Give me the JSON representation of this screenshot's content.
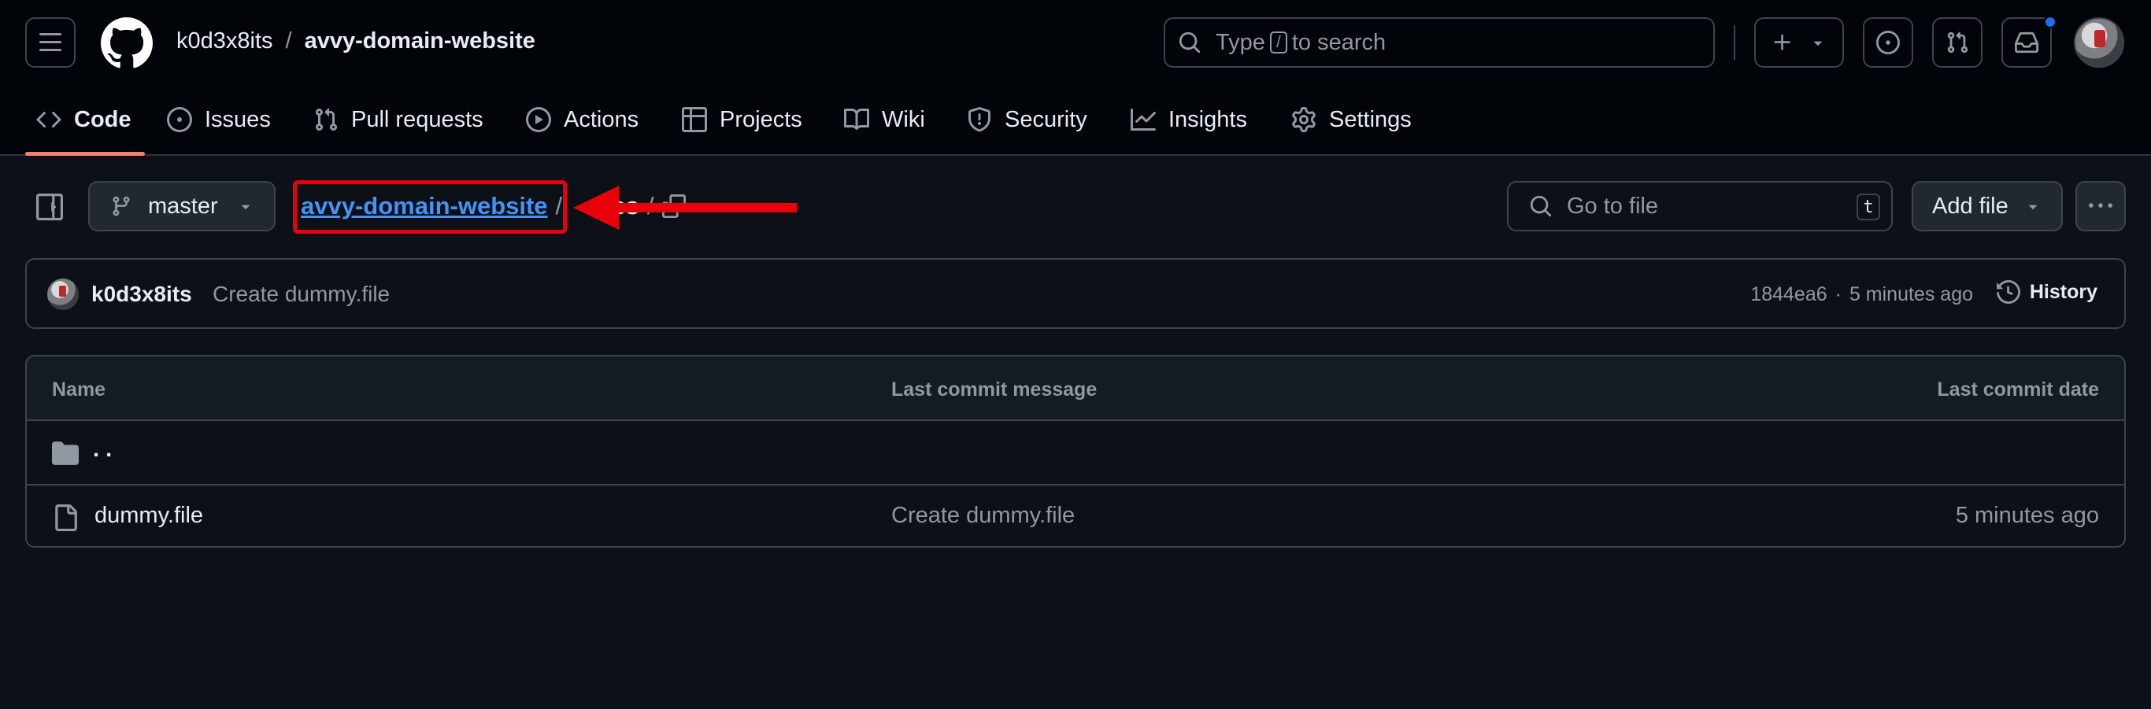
{
  "header": {
    "owner": "k0d3x8its",
    "separator": "/",
    "repo": "avvy-domain-website",
    "search": {
      "prefix": "Type",
      "key": "/",
      "suffix": "to search"
    },
    "notification_dot_color": "#1f6feb"
  },
  "tabs": [
    {
      "label": "Code",
      "icon": "code-icon",
      "active": true
    },
    {
      "label": "Issues",
      "icon": "issue-opened-icon"
    },
    {
      "label": "Pull requests",
      "icon": "git-pull-request-icon"
    },
    {
      "label": "Actions",
      "icon": "play-icon"
    },
    {
      "label": "Projects",
      "icon": "table-icon"
    },
    {
      "label": "Wiki",
      "icon": "book-icon"
    },
    {
      "label": "Security",
      "icon": "shield-icon"
    },
    {
      "label": "Insights",
      "icon": "graph-icon"
    },
    {
      "label": "Settings",
      "icon": "gear-icon"
    }
  ],
  "toolbar": {
    "branch": "master",
    "breadcrumb_root": "avvy-domain-website",
    "breadcrumb_sep": "/",
    "breadcrumb_dir": "css",
    "goto_placeholder": "Go to file",
    "goto_key": "t",
    "add_file_label": "Add file"
  },
  "commit": {
    "author": "k0d3x8its",
    "message": "Create dummy.file",
    "sha": "1844ea6",
    "dot": "·",
    "time": "5 minutes ago",
    "history_label": "History"
  },
  "table": {
    "columns": [
      "Name",
      "Last commit message",
      "Last commit date"
    ],
    "parent_label": ". .",
    "rows": [
      {
        "name": "dummy.file",
        "message": "Create dummy.file",
        "date": "5 minutes ago"
      }
    ]
  },
  "annotation": {
    "highlight_color": "#e8000b",
    "arrow_color": "#e8000b"
  },
  "colors": {
    "link_blue": "#4493f8",
    "active_tab_underline": "#f78166"
  }
}
